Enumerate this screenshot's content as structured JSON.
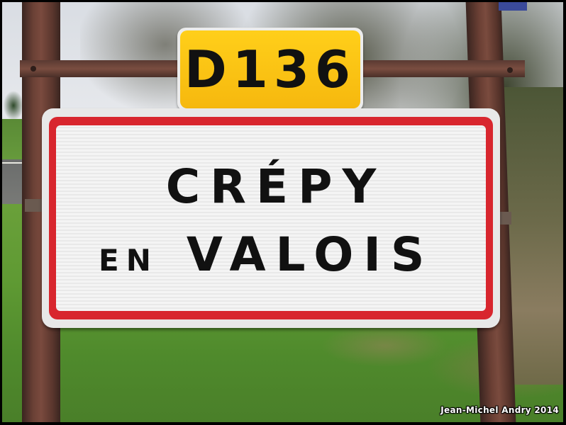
{
  "route_sign": {
    "text": "D136",
    "color": "#f6b80e"
  },
  "town_sign": {
    "line1": "CRÉPY",
    "line2_small": "EN",
    "line2_large": "VALOIS",
    "border_color": "#d8262e",
    "background_color": "#f2f2f2"
  },
  "credit": {
    "text": "Jean-Michel Andry 2014"
  }
}
